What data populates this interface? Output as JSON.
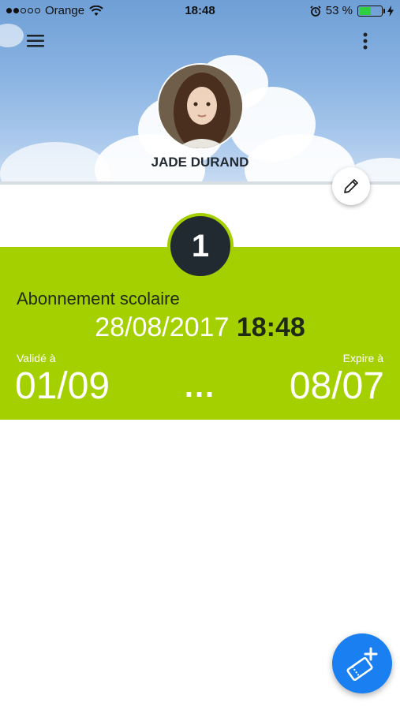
{
  "status_bar": {
    "carrier": "Orange",
    "time": "18:48",
    "battery_percent": "53 %",
    "battery_level": 0.53,
    "signal_bars_filled": 2,
    "signal_bars_total": 5
  },
  "profile": {
    "name": "JADE DURAND"
  },
  "subscription": {
    "badge": "1",
    "title": "Abonnement scolaire",
    "date": "28/08/2017",
    "time": "18:48",
    "valid_label": "Validé à",
    "valid_date": "01/09",
    "separator": "...",
    "expire_label": "Expire à",
    "expire_date": "08/07"
  },
  "colors": {
    "accent_green": "#a5d000",
    "badge_dark": "#222a31",
    "fab_blue": "#1a7ff0"
  },
  "icons": {
    "menu": "hamburger-icon",
    "more": "more-vertical-icon",
    "edit": "pencil-icon",
    "fab": "add-ticket-icon"
  }
}
